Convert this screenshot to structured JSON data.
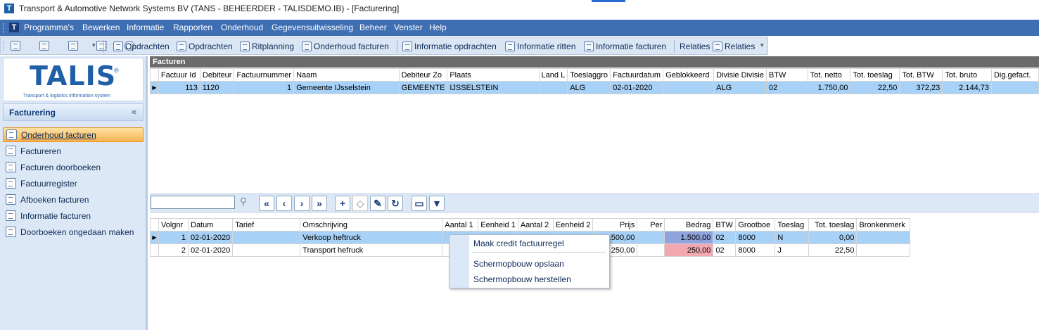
{
  "app": {
    "logo_letter": "T",
    "title": "Transport & Automotive Network Systems BV  (TANS - BEHEERDER - TALISDEMO.IB) - [Facturering]"
  },
  "menu": [
    "Programma's",
    "Bewerken",
    "Informatie",
    "Rapporten",
    "Onderhoud",
    "Gegevensuitwisseling",
    "Beheer",
    "Venster",
    "Help"
  ],
  "toolbar": {
    "buttons": [
      "Opdrachten",
      "Opdrachten",
      "Ritplanning",
      "Onderhoud facturen",
      "Informatie opdrachten",
      "Informatie ritten",
      "Informatie facturen",
      "Relaties",
      "Relaties"
    ]
  },
  "brand": {
    "name": "TALIS",
    "registered": "®",
    "tagline": "Transport & logistics information system"
  },
  "left_panel": {
    "title": "Facturering",
    "collapse": "«",
    "items": [
      "Onderhoud facturen",
      "Factureren",
      "Facturen doorboeken",
      "Factuurregister",
      "Afboeken facturen",
      "Informatie facturen",
      "Doorboeken ongedaan maken"
    ],
    "selected_index": 0
  },
  "facturen": {
    "title": "Facturen",
    "columns": [
      "Factuur Id",
      "Debiteur",
      "Factuurnummer",
      "Naam",
      "Debiteur Zo",
      "Plaats",
      "Land L",
      "Toeslaggro",
      "Factuurdatum",
      "Geblokkeerd",
      "Divisie Divisie",
      "BTW",
      "Tot. netto",
      "Tot. toeslag",
      "Tot. BTW",
      "Tot. bruto",
      "Dig.gefact."
    ],
    "rows": [
      [
        "113",
        "1120",
        "1",
        "Gemeente IJsselstein",
        "GEMEENTE",
        "IJSSELSTEIN",
        "",
        "ALG",
        "02-01-2020",
        "",
        "ALG",
        "02",
        "1.750,00",
        "22,50",
        "372,23",
        "2.144,73",
        ""
      ]
    ]
  },
  "nav": {
    "buttons": [
      "«",
      "‹",
      "›",
      "»",
      "+",
      "◇",
      "✎",
      "↻",
      "▭",
      "▼"
    ]
  },
  "regels": {
    "columns": [
      "Volgnr",
      "Datum",
      "Tarief",
      "Omschrijving",
      "Aantal 1",
      "Eenheid 1",
      "Aantal 2",
      "Eenheid 2",
      "Prijs",
      "Per",
      "Bedrag",
      "BTW",
      "Grootboe",
      "Toeslag",
      "Tot. toeslag",
      "Bronkenmerk"
    ],
    "rows": [
      [
        "1",
        "02-01-2020",
        "",
        "Verkoop heftruck",
        "",
        "",
        "",
        "",
        "1.500,00",
        "",
        "1.500,00",
        "02",
        "8000",
        "N",
        "0,00",
        ""
      ],
      [
        "2",
        "02-01-2020",
        "",
        "Transport hefruck",
        "",
        "",
        "",
        "",
        "250,00",
        "",
        "250,00",
        "02",
        "8000",
        "J",
        "22,50",
        ""
      ]
    ]
  },
  "context_menu": [
    "Maak credit factuurregel",
    "Schermopbouw opslaan",
    "Schermopbouw herstellen"
  ],
  "colors": {
    "menubar": "#3f6fb3",
    "selection": "#a8d1f7",
    "selected_nav": "#f9b454",
    "credit_cell": "#8fa4dc",
    "warn_cell": "#f2a8b0"
  }
}
